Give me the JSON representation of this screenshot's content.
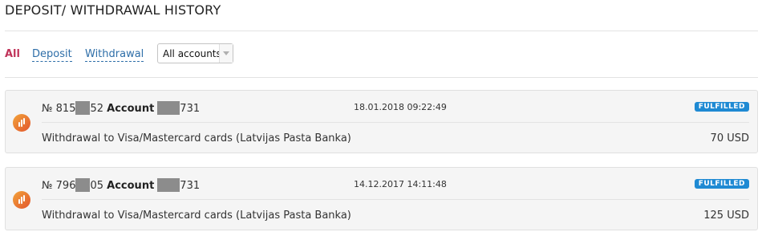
{
  "page": {
    "title": "DEPOSIT/ WITHDRAWAL HISTORY"
  },
  "filters": {
    "all": "All",
    "deposit": "Deposit",
    "withdrawal": "Withdrawal",
    "accounts_select": {
      "value": "All accounts"
    }
  },
  "transactions": [
    {
      "number_prefix": "№ 815",
      "number_suffix": "52",
      "account_label": "Account",
      "account_suffix": "731",
      "datetime": "18.01.2018 09:22:49",
      "status": "FULFILLED",
      "description": "Withdrawal to Visa/Mastercard cards (Latvijas Pasta Banka)",
      "amount": "70 USD"
    },
    {
      "number_prefix": "№ 796",
      "number_suffix": "05",
      "account_label": "Account",
      "account_suffix": "731",
      "datetime": "14.12.2017 14:11:48",
      "status": "FULFILLED",
      "description": "Withdrawal to Visa/Mastercard cards (Latvijas Pasta Banka)",
      "amount": "125 USD"
    }
  ],
  "colors": {
    "active_filter": "#c0345a",
    "link": "#2e6ea8",
    "status_badge": "#1f8ad3",
    "logo_gradient": [
      "#f2a43a",
      "#e2552d"
    ]
  },
  "icons": {
    "transaction_logo": "bars-logo-icon",
    "dropdown": "chevron-down-icon"
  }
}
